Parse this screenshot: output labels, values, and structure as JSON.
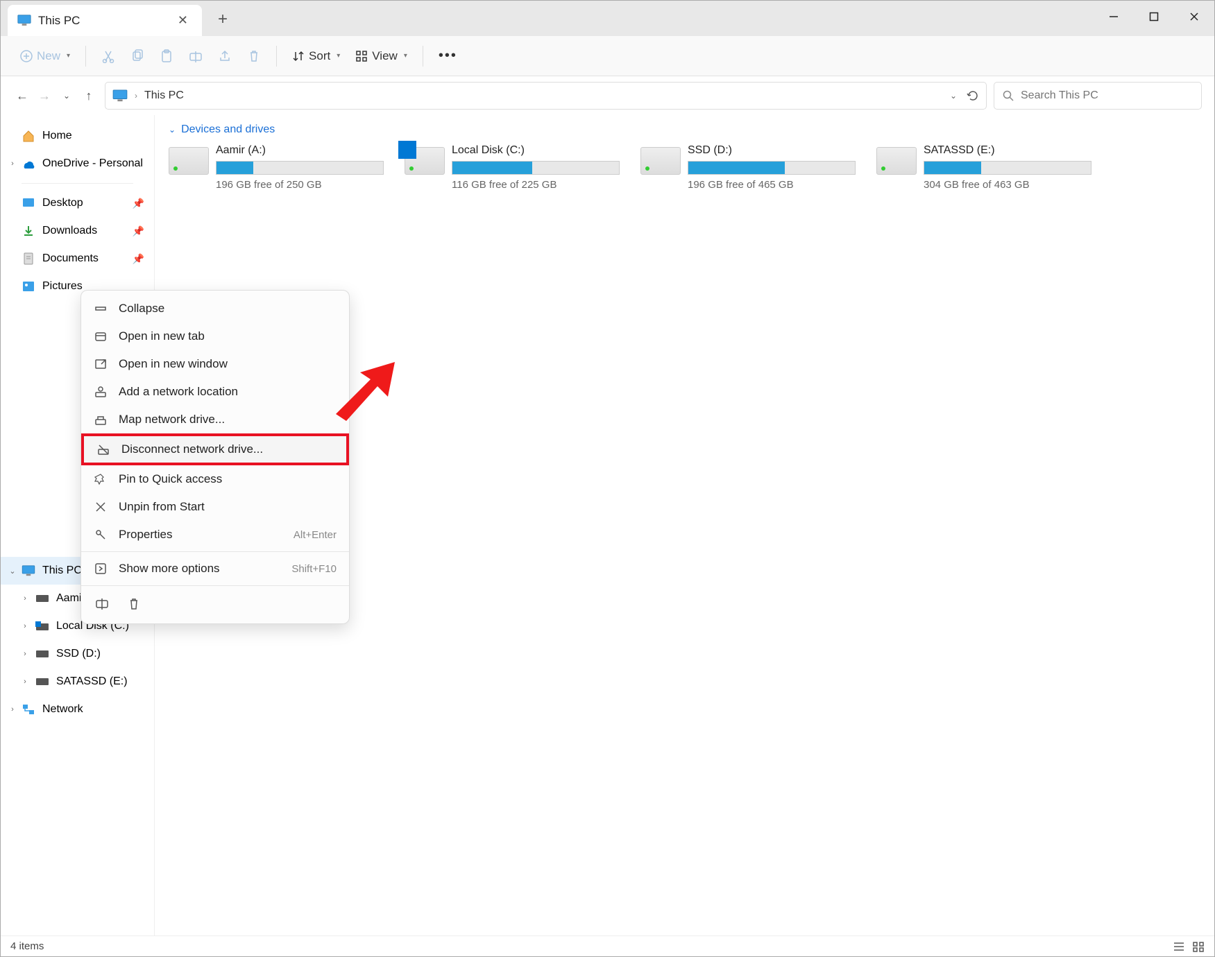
{
  "window": {
    "tab_title": "This PC",
    "new_button": "New",
    "sort_button": "Sort",
    "view_button": "View"
  },
  "address": {
    "location": "This PC"
  },
  "search": {
    "placeholder": "Search This PC"
  },
  "sidebar": {
    "home": "Home",
    "onedrive": "OneDrive - Personal",
    "desktop": "Desktop",
    "downloads": "Downloads",
    "documents": "Documents",
    "pictures": "Pictures",
    "thispc": "This PC",
    "aamir": "Aamir",
    "localdisk": "Local Disk (C:)",
    "ssd": "SSD (D:)",
    "satassd": "SATASSD (E:)",
    "network": "Network"
  },
  "content": {
    "section": "Devices and drives",
    "drives": [
      {
        "name": "Aamir (A:)",
        "info": "196 GB free of 250 GB",
        "fill": 22,
        "win": false
      },
      {
        "name": "Local Disk (C:)",
        "info": "116 GB free of 225 GB",
        "fill": 48,
        "win": true
      },
      {
        "name": "SSD (D:)",
        "info": "196 GB free of 465 GB",
        "fill": 58,
        "win": false
      },
      {
        "name": "SATASSD (E:)",
        "info": "304 GB free of 463 GB",
        "fill": 34,
        "win": false
      }
    ]
  },
  "context_menu": {
    "items": [
      {
        "icon": "collapse-icon",
        "label": "Collapse",
        "shortcut": ""
      },
      {
        "icon": "tab-icon",
        "label": "Open in new tab",
        "shortcut": ""
      },
      {
        "icon": "window-icon",
        "label": "Open in new window",
        "shortcut": ""
      },
      {
        "icon": "netloc-icon",
        "label": "Add a network location",
        "shortcut": ""
      },
      {
        "icon": "mapdrive-icon",
        "label": "Map network drive...",
        "shortcut": ""
      },
      {
        "icon": "disconnect-icon",
        "label": "Disconnect network drive...",
        "shortcut": "",
        "highlight": true
      },
      {
        "icon": "pin-icon",
        "label": "Pin to Quick access",
        "shortcut": ""
      },
      {
        "icon": "unpin-icon",
        "label": "Unpin from Start",
        "shortcut": ""
      },
      {
        "icon": "properties-icon",
        "label": "Properties",
        "shortcut": "Alt+Enter"
      },
      {
        "sep": true
      },
      {
        "icon": "more-icon",
        "label": "Show more options",
        "shortcut": "Shift+F10"
      },
      {
        "sep": true
      },
      {
        "iconrow": true
      }
    ]
  },
  "status": {
    "text": "4 items"
  }
}
